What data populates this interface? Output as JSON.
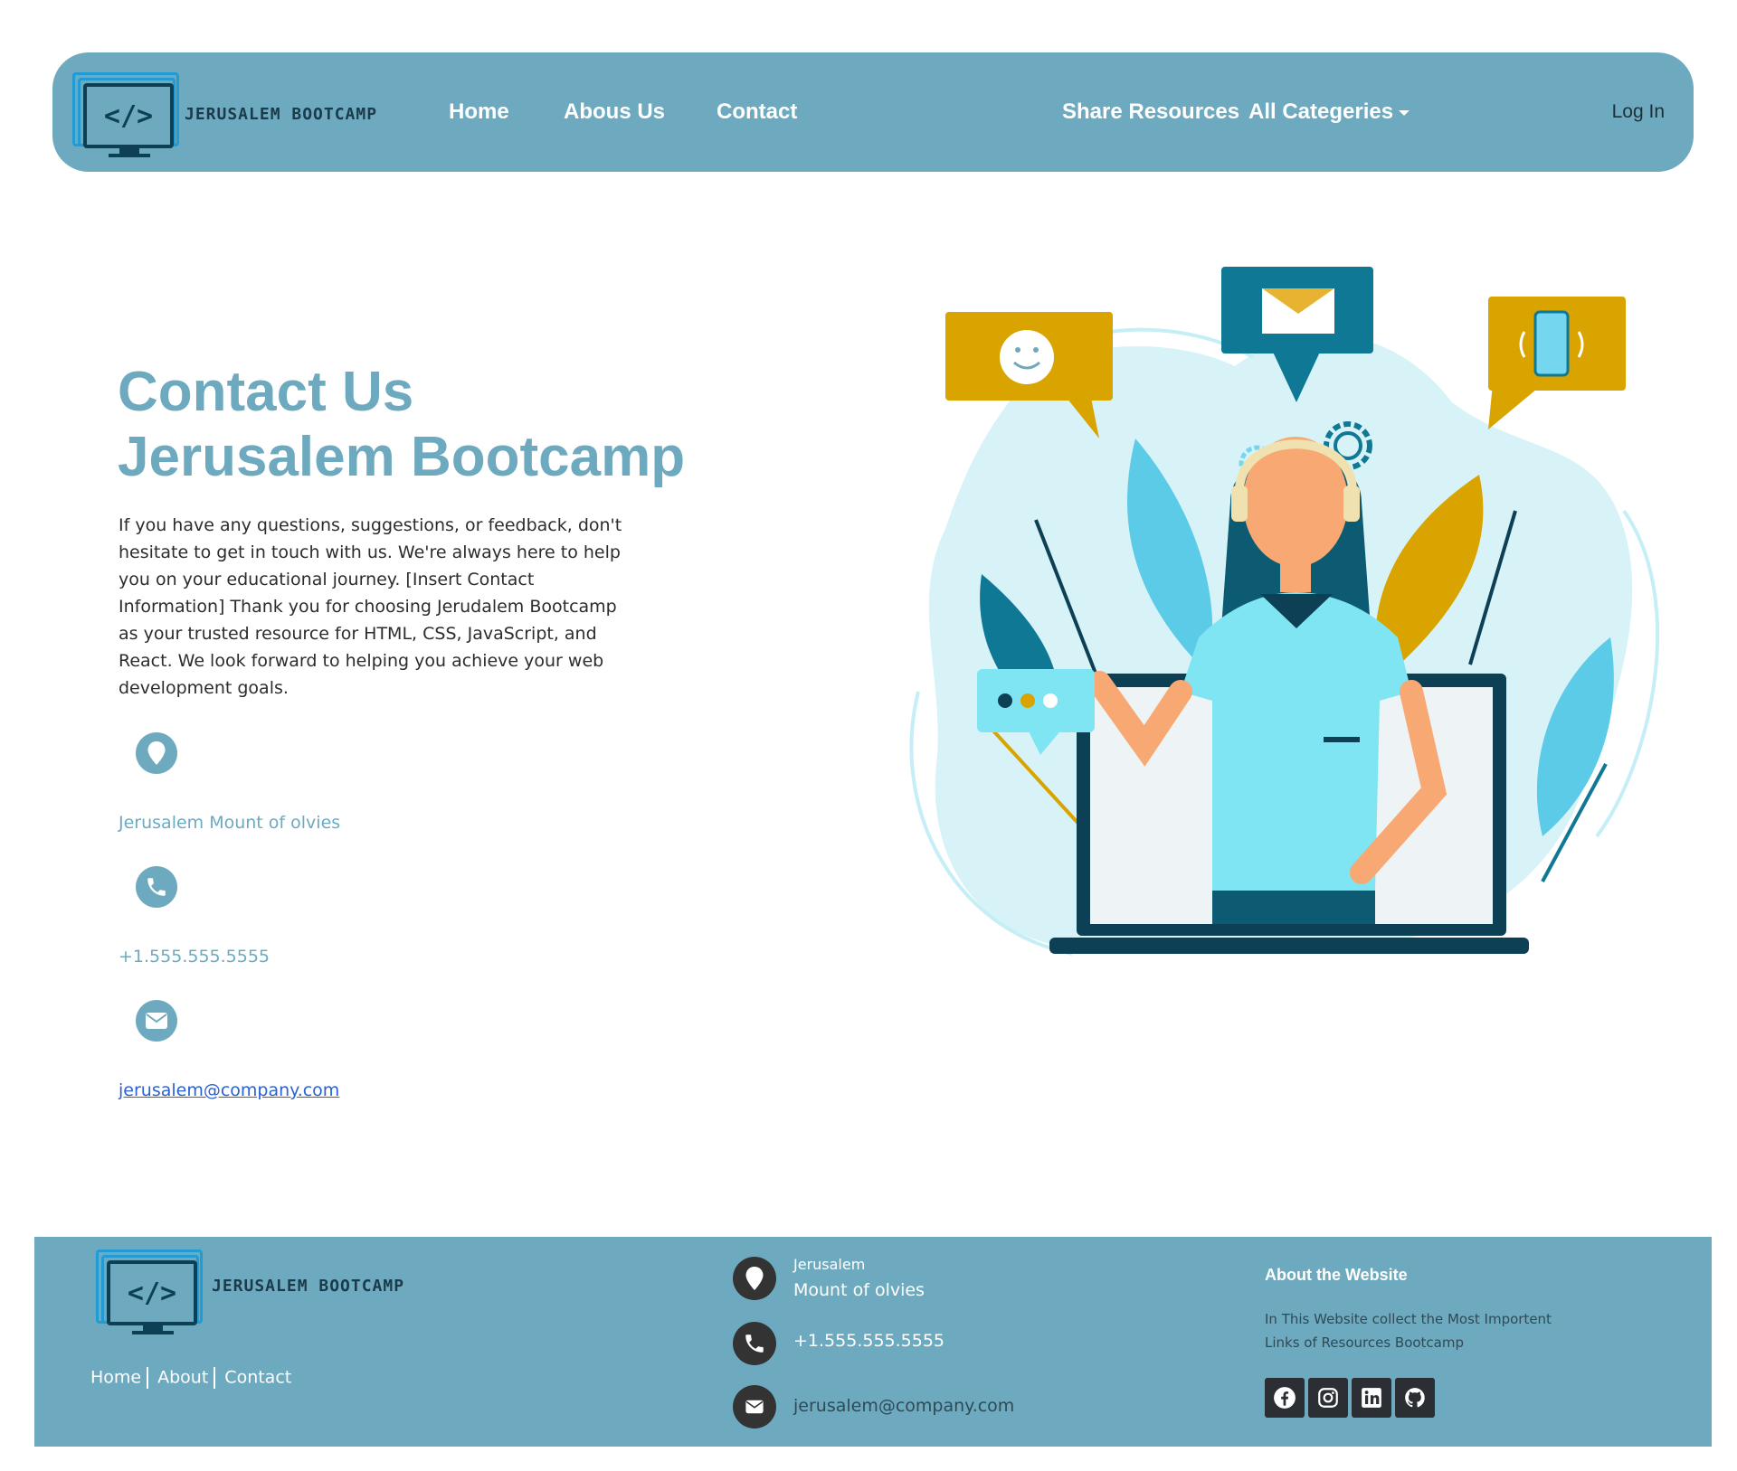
{
  "navbar": {
    "brand_text": "JERUSALEM BOOTCAMP",
    "brand_code": "</>",
    "links": [
      "Home",
      "Abous Us",
      "Contact"
    ],
    "share": "Share Resources",
    "categories": "All Categeries",
    "login": "Log In"
  },
  "hero": {
    "title_line1": "Contact Us",
    "title_line2": "Jerusalem Bootcamp",
    "description": "If you have any questions, suggestions, or feedback, don't hesitate to get in touch with us. We're always here to help you on your educational journey. [Insert Contact Information] Thank you for choosing Jerudalem Bootcamp as your trusted resource for HTML, CSS, JavaScript, and React. We look forward to helping you achieve your web development goals.",
    "address": "Jerusalem Mount of olvies",
    "phone": "+1.555.555.5555",
    "email": "jerusalem@company.com"
  },
  "footer": {
    "brand_text": "JERUSALEM BOOTCAMP",
    "brand_code": "</>",
    "links": [
      "Home",
      "About",
      "Contact"
    ],
    "address_city": "Jerusalem",
    "address_place": "Mount of olvies",
    "phone": "+1.555.555.5555",
    "email": "jerusalem@company.com",
    "about_title": "About the Website",
    "about_text": "In This Website collect the Most Importent Links of Resources Bootcamp",
    "social_icons": [
      "facebook-icon",
      "instagram-icon",
      "linkedin-icon",
      "github-icon"
    ]
  },
  "colors": {
    "primary": "#6eaabf",
    "dark": "#0d3f55",
    "footer_icon_bg": "#333333",
    "link": "#2a62d4"
  }
}
